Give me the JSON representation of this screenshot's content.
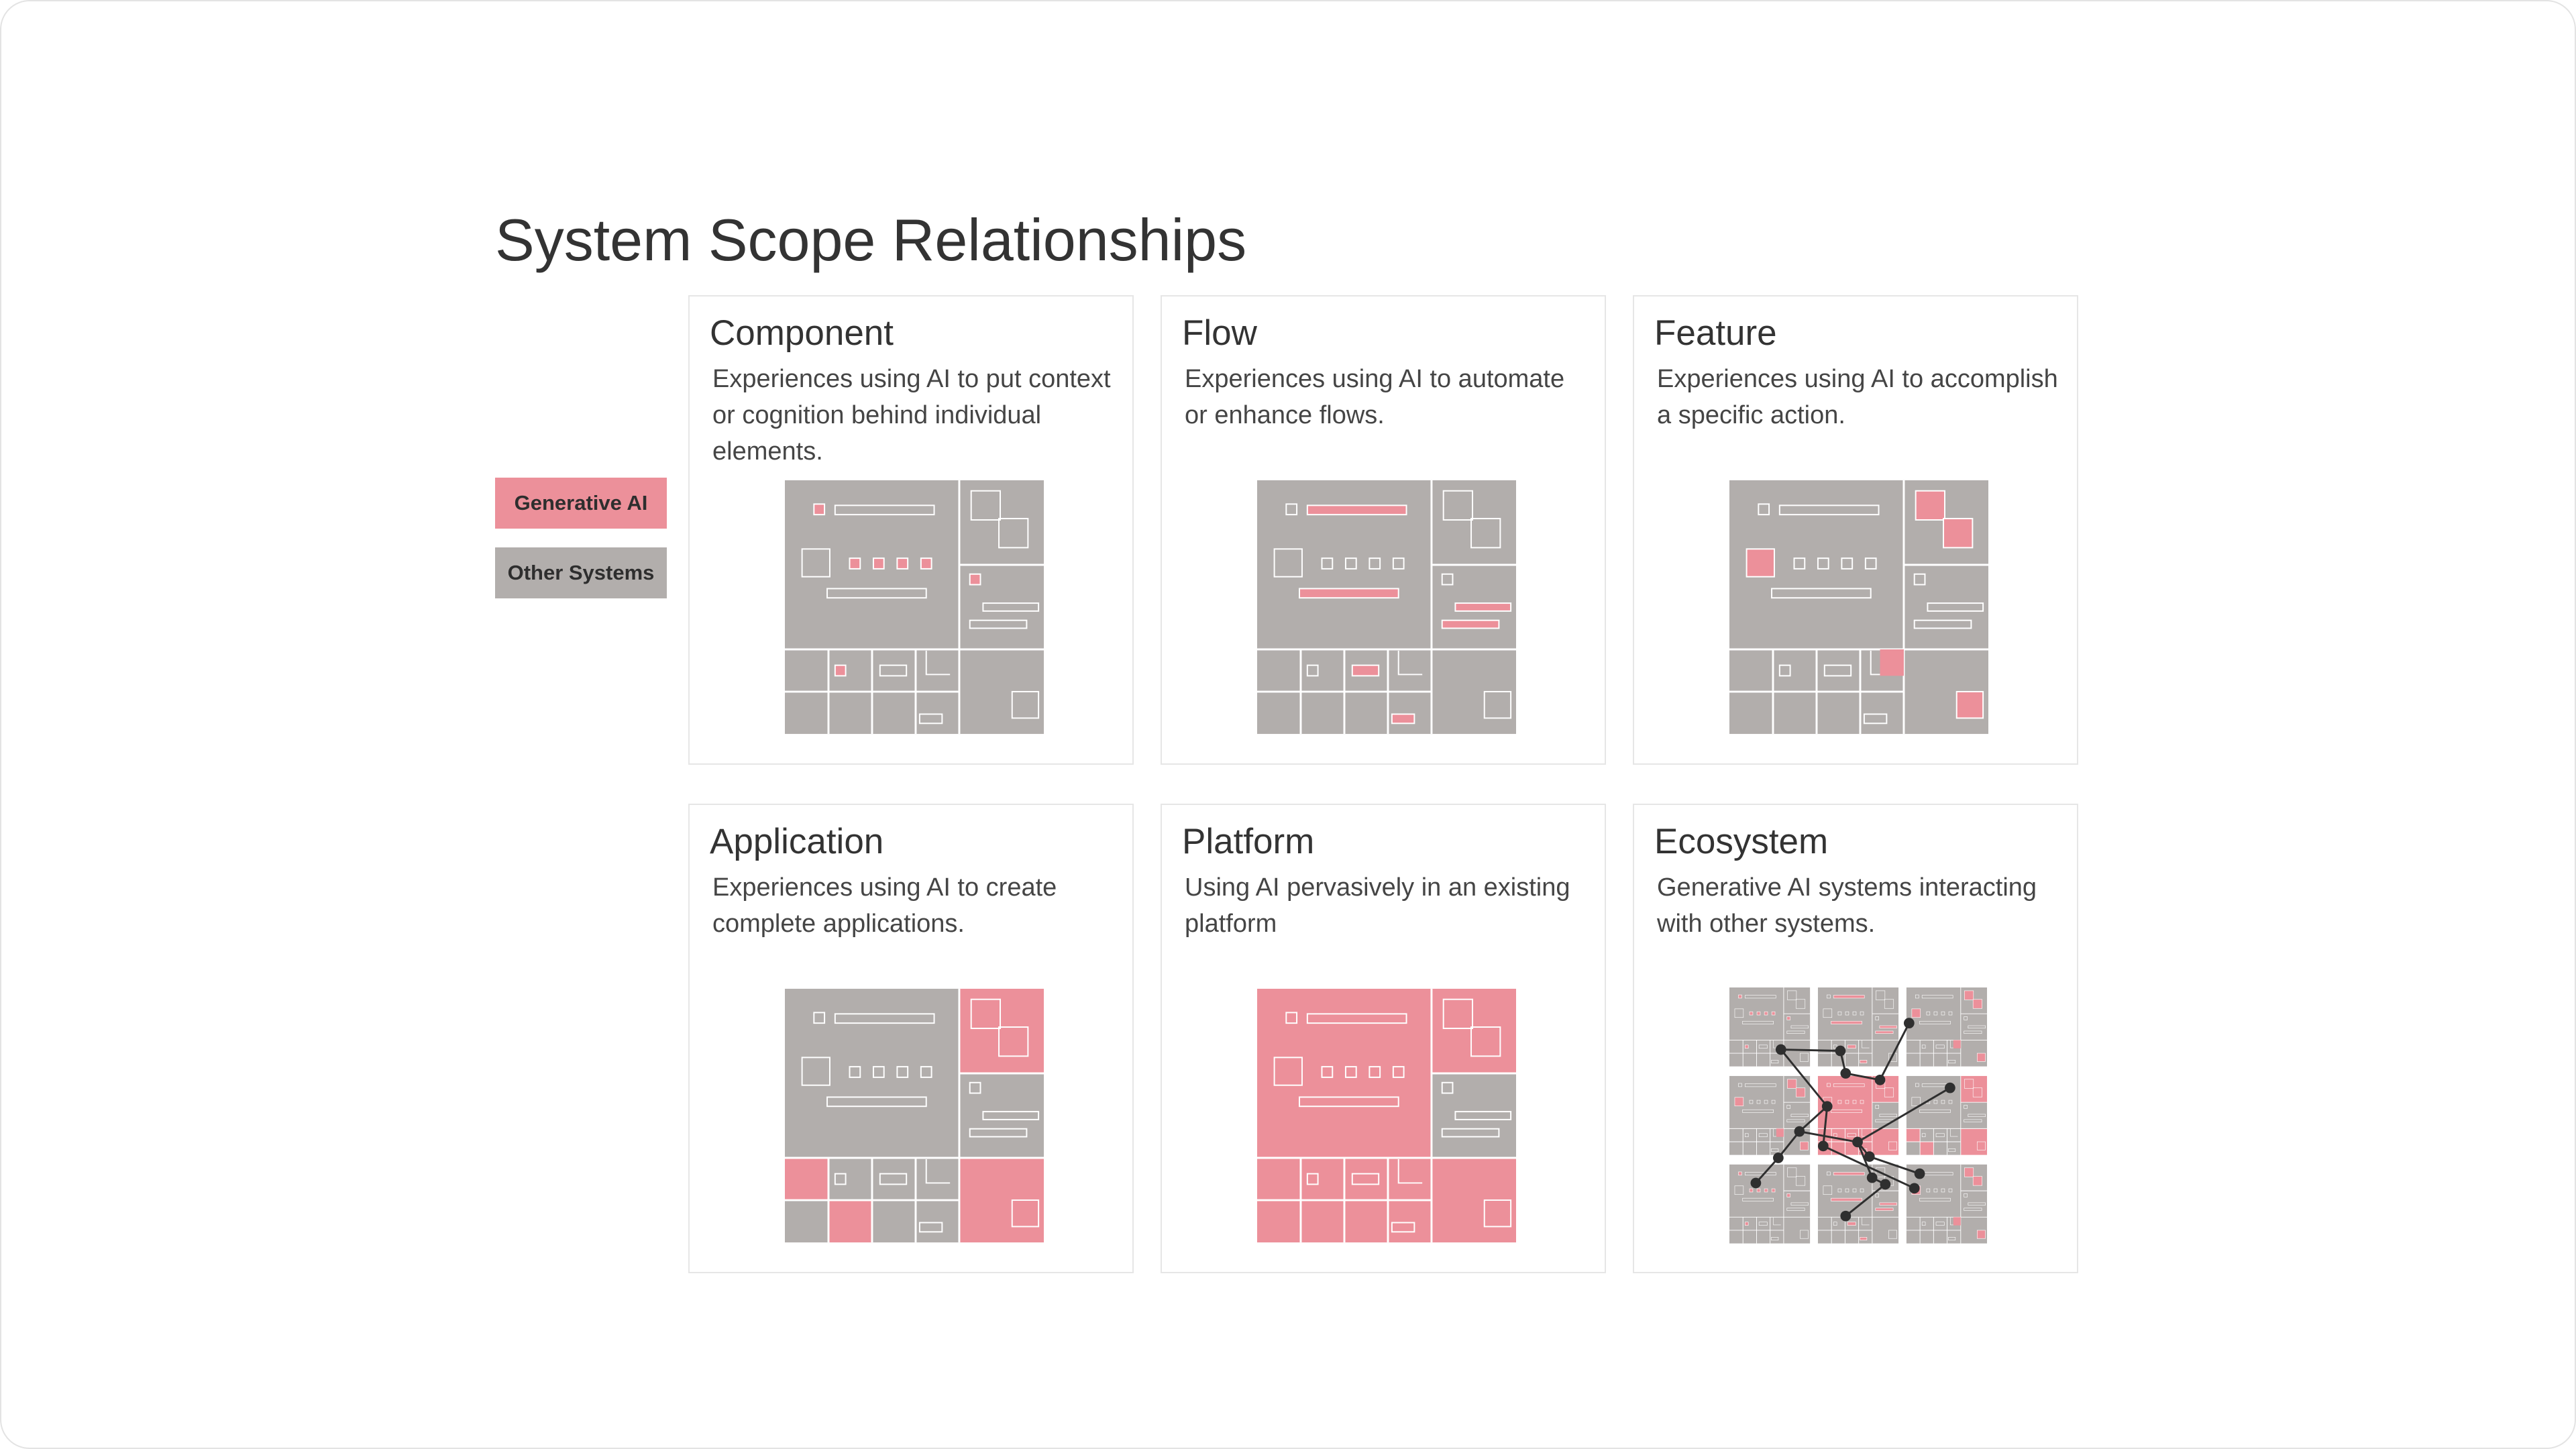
{
  "title": "System Scope Relationships",
  "colors": {
    "generative": "#ec909a",
    "other": "#b2aeac",
    "line": "#ffffff",
    "connector": "#2f2f2f"
  },
  "legend": [
    {
      "label": "Generative AI",
      "color": "#ec909a"
    },
    {
      "label": "Other Systems",
      "color": "#b2aeac"
    }
  ],
  "cards": [
    {
      "title": "Component",
      "description": "Experiences using AI to put context or cognition behind individual elements.",
      "scope": "component"
    },
    {
      "title": "Flow",
      "description": "Experiences using AI to automate or enhance flows.",
      "scope": "flow"
    },
    {
      "title": "Feature",
      "description": "Experiences using AI to accomplish a specific action.",
      "scope": "feature"
    },
    {
      "title": "Application",
      "description": "Experiences using AI to create complete applications.",
      "scope": "application"
    },
    {
      "title": "Platform",
      "description": "Using AI pervasively in an existing platform",
      "scope": "platform"
    },
    {
      "title": "Ecosystem",
      "description": "Generative AI systems interacting with other systems.",
      "scope": "ecosystem"
    }
  ]
}
